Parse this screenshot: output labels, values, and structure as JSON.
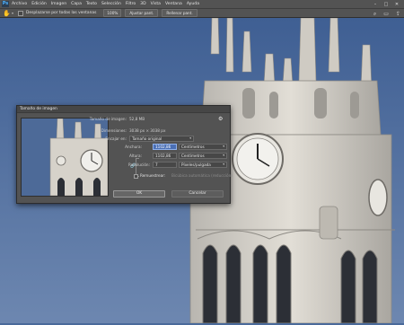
{
  "app": {
    "logo": "Ps"
  },
  "menubar": {
    "items": [
      "Archivo",
      "Edición",
      "Imagen",
      "Capa",
      "Texto",
      "Selección",
      "Filtro",
      "3D",
      "Vista",
      "Ventana",
      "Ayuda"
    ],
    "window_controls": [
      "–",
      "□",
      "✕"
    ]
  },
  "optionsbar": {
    "tool_icon": "hand-icon",
    "scroll_all_label": "Desplazarse por todas las ventanas",
    "zoom_value": "100%",
    "fit_screen_label": "Ajustar pant.",
    "fill_screen_label": "Rellenar pant.",
    "right_icons": [
      "search-icon",
      "workspace-icon",
      "share-icon"
    ]
  },
  "dialog": {
    "title": "Tamaño de imagen",
    "image_size_label": "Tamaño de imagen:",
    "image_size_value": "52,8 MB",
    "dimensions_label": "Dimensiones:",
    "dimensions_value": "3038 px × 3038 px",
    "fit_to_label": "Encajar en:",
    "fit_to_value": "Tamaño original",
    "width_label": "Anchura:",
    "width_value": "1102,86",
    "width_unit": "Centímetros",
    "height_label": "Altura:",
    "height_value": "1102,86",
    "height_unit": "Centímetros",
    "resolution_label": "Resolución:",
    "resolution_value": "7",
    "resolution_unit": "Píxeles/pulgada",
    "resample_label": "Remuestrear:",
    "resample_value": "Bicúbica automática (reducción)",
    "ok_label": "OK",
    "cancel_label": "Cancelar"
  },
  "colors": {
    "ui_bg": "#535353",
    "selection": "#4a6fb5",
    "sky": "#4a6a9a",
    "stone": "#d8d4cc"
  }
}
